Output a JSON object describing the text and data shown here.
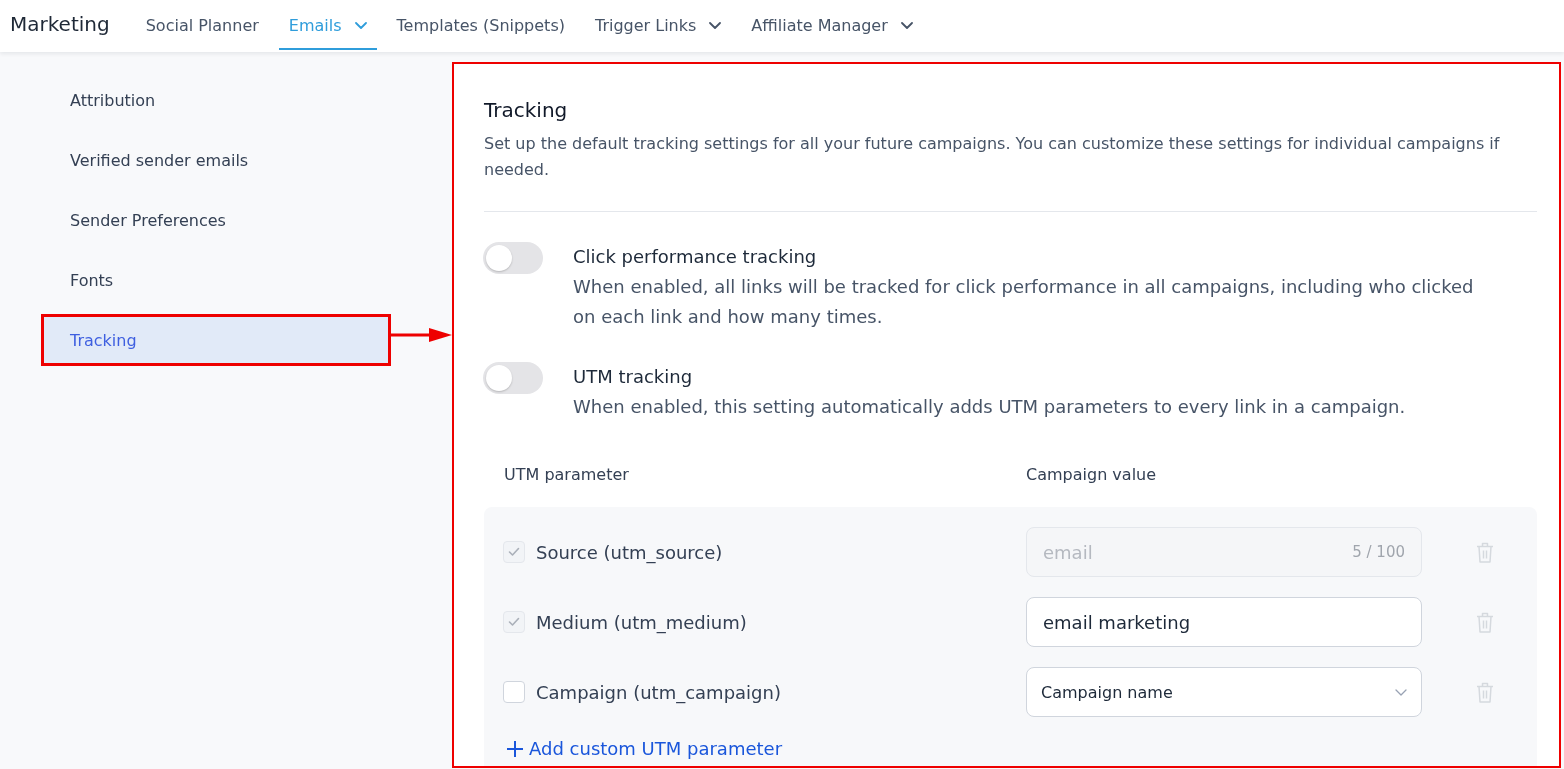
{
  "nav": {
    "title": "Marketing",
    "tabs": [
      {
        "label": "Social Planner",
        "selected": false,
        "has_menu": false
      },
      {
        "label": "Emails",
        "selected": true,
        "has_menu": true
      },
      {
        "label": "Templates (Snippets)",
        "selected": false,
        "has_menu": false
      },
      {
        "label": "Trigger Links",
        "selected": false,
        "has_menu": true
      },
      {
        "label": "Affiliate Manager",
        "selected": false,
        "has_menu": true
      }
    ]
  },
  "sidebar": {
    "items": [
      {
        "label": "Attribution",
        "selected": false
      },
      {
        "label": "Verified sender emails",
        "selected": false
      },
      {
        "label": "Sender Preferences",
        "selected": false
      },
      {
        "label": "Fonts",
        "selected": false
      },
      {
        "label": "Tracking",
        "selected": true
      }
    ]
  },
  "panel": {
    "title": "Tracking",
    "description": "Set up the default tracking settings for all your future campaigns. You can customize these settings for individual campaigns if needed."
  },
  "settings": [
    {
      "label": "Click performance tracking",
      "description": "When enabled, all links will be tracked for click performance in all campaigns, including who clicked on each link and how many times.",
      "on": false
    },
    {
      "label": "UTM tracking",
      "description": "When enabled, this setting automatically adds UTM parameters to every link in a campaign.",
      "on": false
    }
  ],
  "utm": {
    "columns": [
      "UTM parameter",
      "Campaign value"
    ],
    "rows": [
      {
        "label": "Source (utm_source)",
        "checked": true,
        "disabled": true,
        "field": {
          "kind": "text",
          "value": "email",
          "counter": "5 / 100",
          "disabled": true
        },
        "delete_disabled": true
      },
      {
        "label": "Medium (utm_medium)",
        "checked": true,
        "disabled": true,
        "field": {
          "kind": "text",
          "value": "email marketing",
          "disabled": false
        },
        "delete_disabled": true
      },
      {
        "label": "Campaign (utm_campaign)",
        "checked": false,
        "disabled": false,
        "field": {
          "kind": "select",
          "value": "Campaign name",
          "disabled": false
        },
        "delete_disabled": true
      }
    ],
    "add_link": "Add custom UTM parameter"
  }
}
